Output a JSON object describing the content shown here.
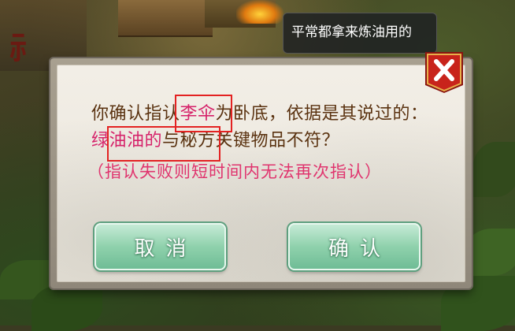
{
  "speech_bubble": {
    "text": "平常都拿来炼油用的"
  },
  "dialog": {
    "message": {
      "part1": "你确认指认",
      "accused": "李伞",
      "part2": "为卧底，依据是其说过的：",
      "evidence": "绿油油的",
      "part3": "与秘方关键物品不符？"
    },
    "warning": "（指认失败则短时间内无法再次指认）",
    "buttons": {
      "cancel": "取消",
      "confirm": "确认"
    },
    "close_icon": "close-x-icon"
  },
  "colors": {
    "message_text": "#5a3210",
    "highlight": "#d6226a",
    "warning": "#e0346e",
    "button_green": "#8fd1ac",
    "close_red": "#c8231b",
    "annotation_red": "#e32222"
  }
}
